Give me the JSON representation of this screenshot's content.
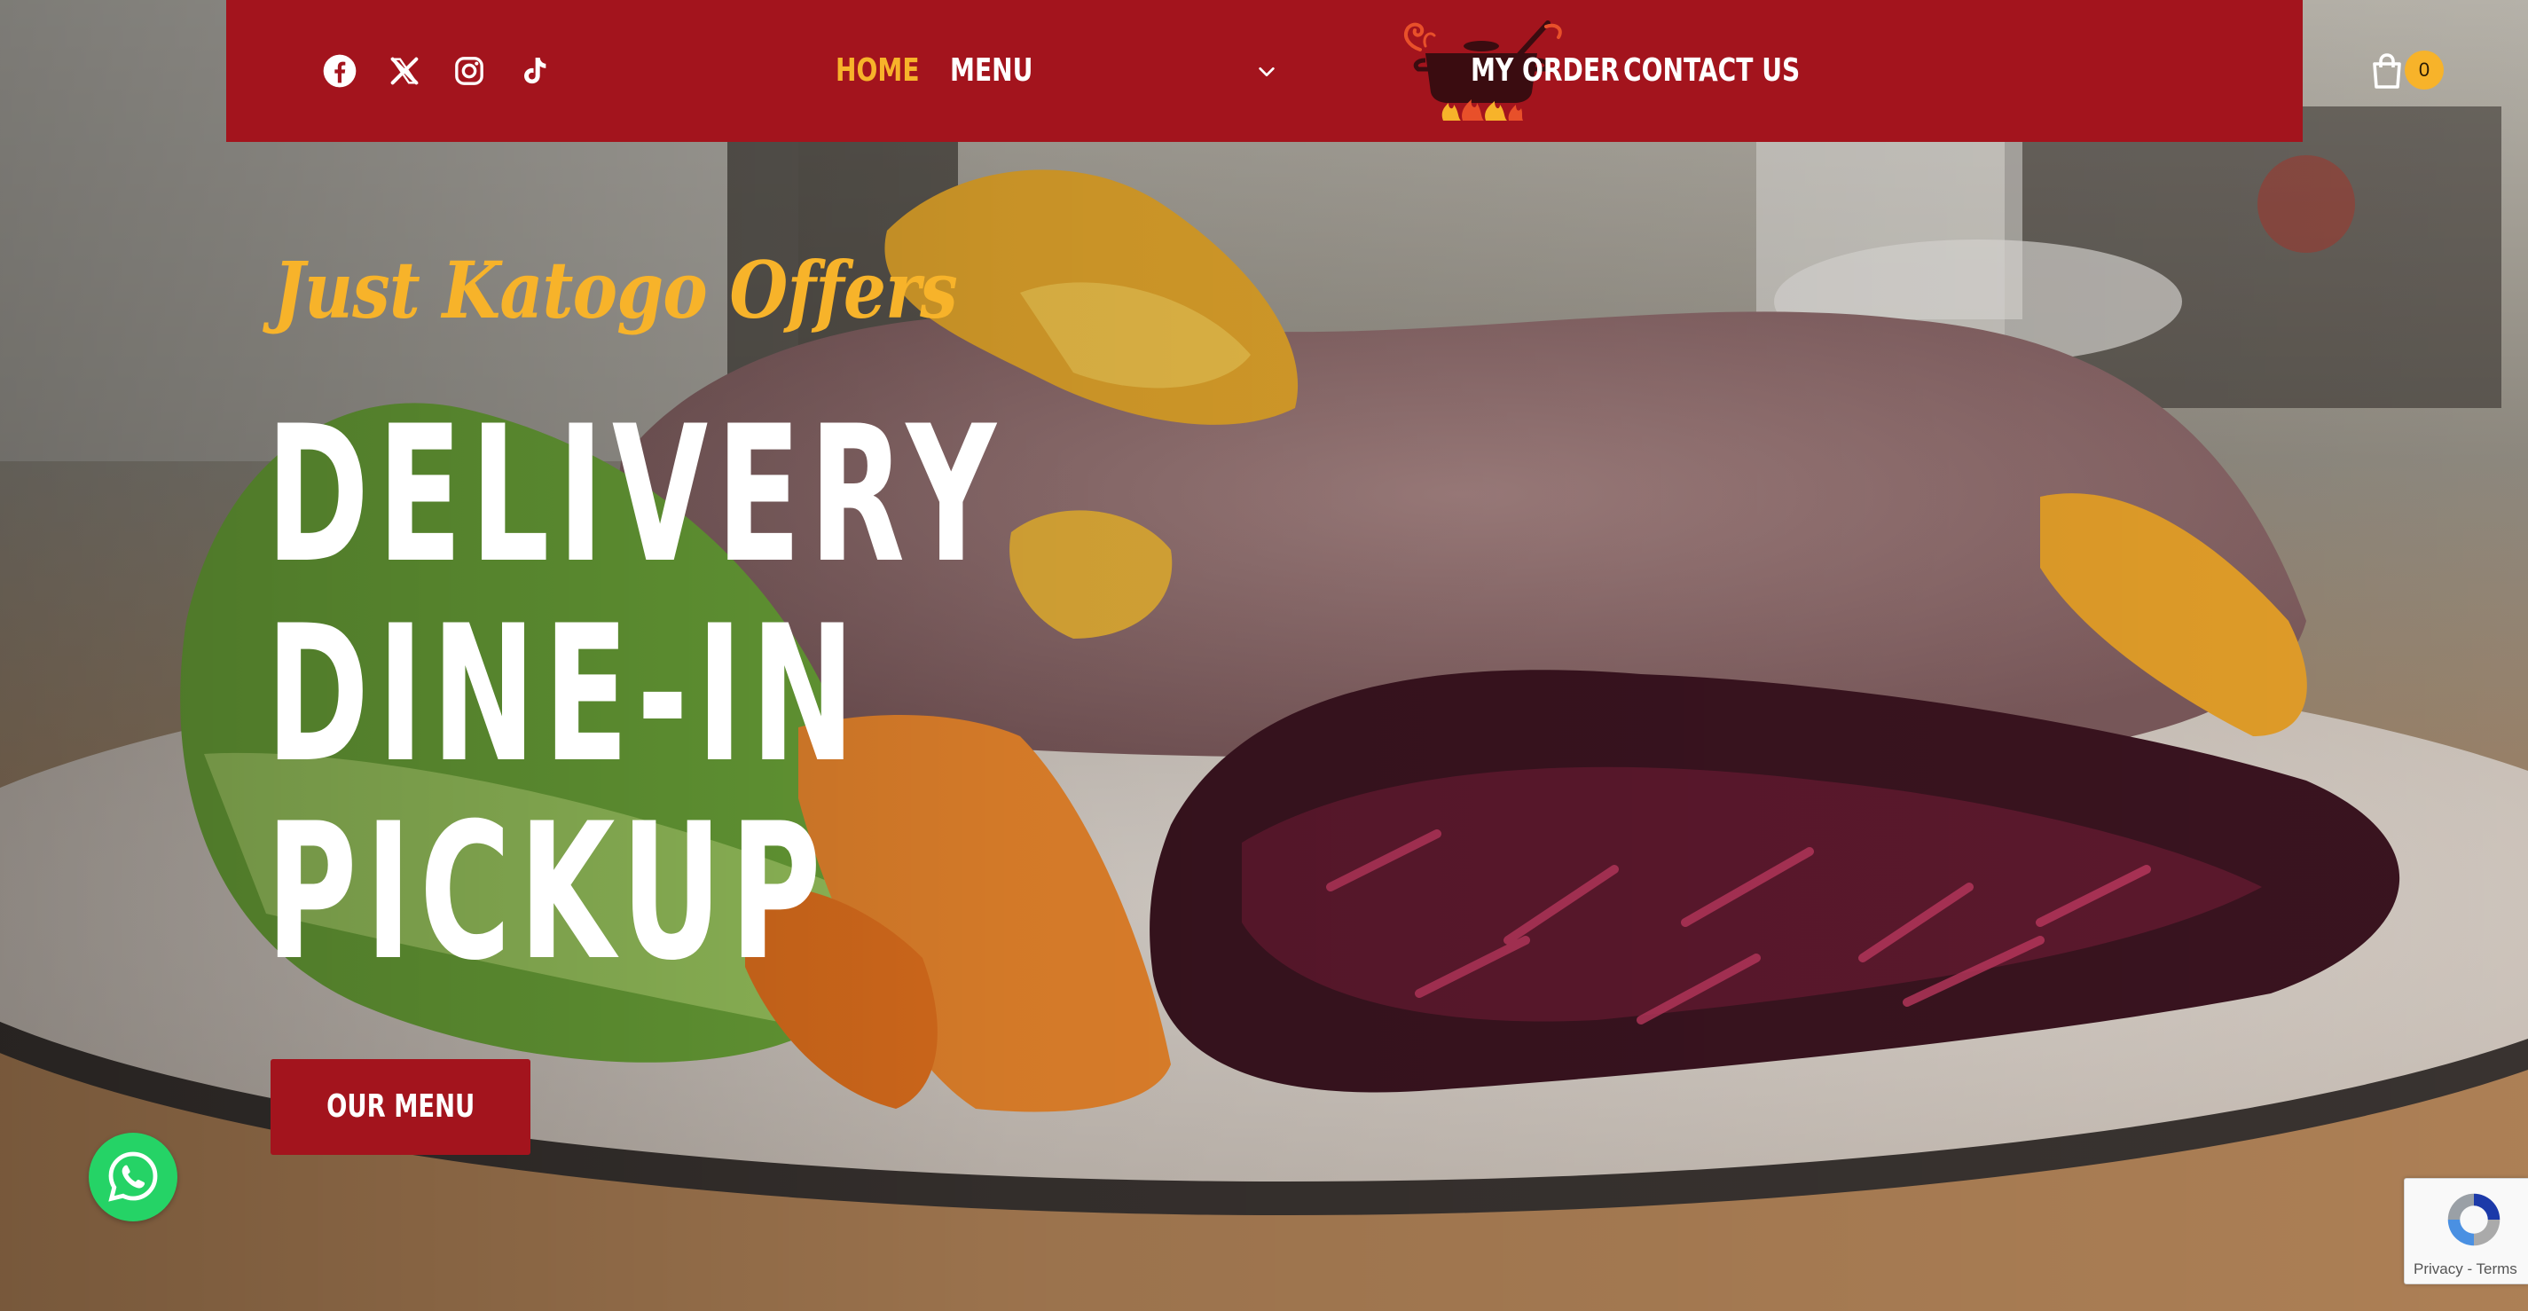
{
  "colors": {
    "brand_red": "#a3141d",
    "accent_yellow": "#f7b32a",
    "white": "#ffffff",
    "whatsapp_green": "#25d366"
  },
  "header": {
    "social_icons": [
      "facebook-icon",
      "x-twitter-icon",
      "instagram-icon",
      "tiktok-icon"
    ],
    "nav": {
      "home": "HOME",
      "menu": "MENU",
      "my_order": "MY ORDER",
      "contact": "CONTACT US"
    },
    "cart": {
      "icon": "shopping-bag-icon",
      "count": "0"
    }
  },
  "hero": {
    "tagline": "Just Katogo Offers",
    "lines": [
      "DELIVERY",
      "DINE-IN",
      "PICKUP"
    ],
    "cta_label": "OUR MENU"
  },
  "widgets": {
    "whatsapp_icon": "whatsapp-icon",
    "recaptcha_text": "Privacy - Terms"
  }
}
